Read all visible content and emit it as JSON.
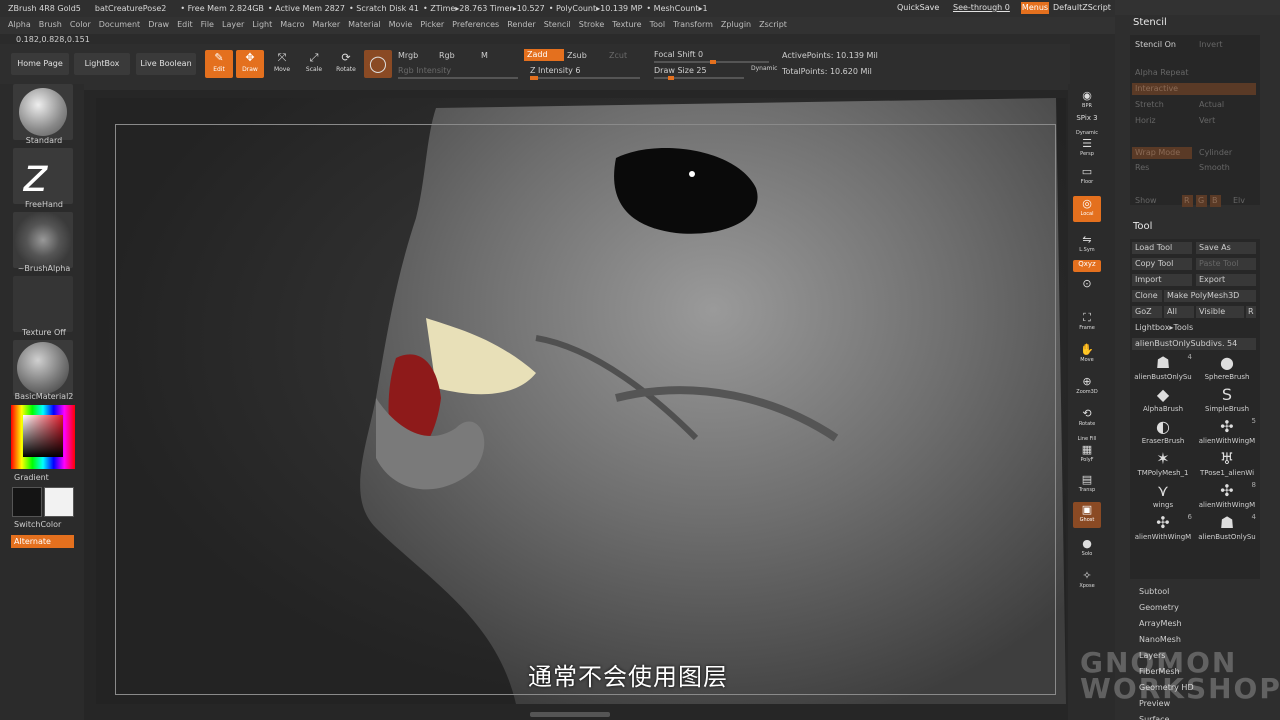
{
  "titlebar": {
    "app": "ZBrush 4R8 Gold5",
    "document": "batCreaturePose2",
    "free_mem": "• Free Mem 2.824GB",
    "active_mem": "• Active Mem 2827",
    "scratch_disk": "• Scratch Disk 41",
    "ztime": "• ZTime▸28.763 Timer▸10.527",
    "polycount": "• PolyCount▸10.139 MP",
    "meshcount": "• MeshCount▸1",
    "quicksave": "QuickSave",
    "see_through": "See-through 0",
    "menus": "Menus",
    "default_script": "DefaultZScript"
  },
  "menu": [
    "Alpha",
    "Brush",
    "Color",
    "Document",
    "Draw",
    "Edit",
    "File",
    "Layer",
    "Light",
    "Macro",
    "Marker",
    "Material",
    "Movie",
    "Picker",
    "Preferences",
    "Render",
    "Stencil",
    "Stroke",
    "Texture",
    "Tool",
    "Transform",
    "Zplugin",
    "Zscript"
  ],
  "coords": "0.182,0.828,0.151",
  "shelf": {
    "home_page": "Home Page",
    "lightbox": "LightBox",
    "live_boolean": "Live Boolean",
    "edit": "Edit",
    "draw": "Draw",
    "move": "Move",
    "scale": "Scale",
    "rotate": "Rotate",
    "mrgb": "Mrgb",
    "rgb": "Rgb",
    "m": "M",
    "rgb_intensity": "Rgb Intensity",
    "zadd": "Zadd",
    "zsub": "Zsub",
    "zcut": "Zcut",
    "z_intensity": "Z Intensity 6",
    "focal_shift": "Focal Shift 0",
    "draw_size": "Draw Size 25",
    "dynamic": "Dynamic",
    "active_points": "ActivePoints: 10.139 Mil",
    "total_points": "TotalPoints: 10.620 Mil"
  },
  "left": {
    "standard": "Standard",
    "freehand": "FreeHand",
    "brush_alpha": "~BrushAlpha",
    "texture_off": "Texture Off",
    "material": "BasicMaterial2",
    "gradient": "Gradient",
    "switch_color": "SwitchColor",
    "alternate": "Alternate"
  },
  "right_shelf": {
    "bpr": "BPR",
    "spix": "SPix 3",
    "dynamic": "Dynamic",
    "persp": "Persp",
    "floor": "Floor",
    "local": "Local",
    "lsym": "L.Sym",
    "xyz": "Qxyz",
    "frame": "Frame",
    "move": "Move",
    "zoom3d": "Zoom3D",
    "rotate": "Rotate",
    "line_fill": "Line Fill",
    "polyf": "PolyF",
    "transp": "Transp",
    "ghost": "Ghost",
    "solo": "Solo",
    "xpose": "Xpose"
  },
  "stencil": {
    "title": "Stencil",
    "stencil_on": "Stencil On",
    "invert": "Invert",
    "alpha_repeat": "Alpha Repeat",
    "interactive": "Interactive",
    "stretch": "Stretch",
    "actual": "Actual",
    "horiz": "Horiz",
    "vert": "Vert",
    "wrap_mode": "Wrap Mode",
    "cylinder": "Cylinder",
    "res": "Res",
    "smooth": "Smooth",
    "show": "Show",
    "r": "R",
    "g": "G",
    "b": "B",
    "elv": "Elv"
  },
  "tool": {
    "title": "Tool",
    "load_tool": "Load Tool",
    "save_as": "Save As",
    "copy_tool": "Copy Tool",
    "paste_tool": "Paste Tool",
    "import": "Import",
    "export": "Export",
    "clone": "Clone",
    "make_polymesh": "Make PolyMesh3D",
    "goz": "GoZ",
    "all": "All",
    "visible": "Visible",
    "r": "R",
    "lightbox_tools": "Lightbox▸Tools",
    "current_tool": "alienBustOnlySubdivs. 54",
    "thumbs": [
      {
        "name": "alienBustOnlySu",
        "count": "4",
        "icon": "bust-icon",
        "glyph": "☗"
      },
      {
        "name": "SphereBrush",
        "count": "",
        "icon": "sphere-icon",
        "glyph": "●"
      },
      {
        "name": "AlphaBrush",
        "count": "",
        "icon": "alpha-brush-icon",
        "glyph": "◆"
      },
      {
        "name": "SimpleBrush",
        "count": "",
        "icon": "simple-brush-icon",
        "glyph": "S"
      },
      {
        "name": "EraserBrush",
        "count": "",
        "icon": "eraser-icon",
        "glyph": "◐"
      },
      {
        "name": "alienWithWingM",
        "count": "5",
        "icon": "creature-icon",
        "glyph": "✣"
      },
      {
        "name": "TMPolyMesh_1",
        "count": "",
        "icon": "star-icon",
        "glyph": "✶"
      },
      {
        "name": "TPose1_alienWi",
        "count": "",
        "icon": "tpose-icon",
        "glyph": "♅"
      },
      {
        "name": "wings",
        "count": "",
        "icon": "wings-icon",
        "glyph": "⋎"
      },
      {
        "name": "alienWithWingM",
        "count": "8",
        "icon": "creature-icon",
        "glyph": "✣"
      },
      {
        "name": "alienWithWingM",
        "count": "6",
        "icon": "creature-icon",
        "glyph": "✣"
      },
      {
        "name": "alienBustOnlySu",
        "count": "4",
        "icon": "bust-icon",
        "glyph": "☗"
      }
    ],
    "sections": [
      "Subtool",
      "Geometry",
      "ArrayMesh",
      "NanoMesh",
      "Layers",
      "FiberMesh",
      "Geometry HD",
      "Preview",
      "Surface"
    ]
  },
  "subtitle": "通常不会使用图层",
  "watermark": "GNOMON WORKSHOP"
}
